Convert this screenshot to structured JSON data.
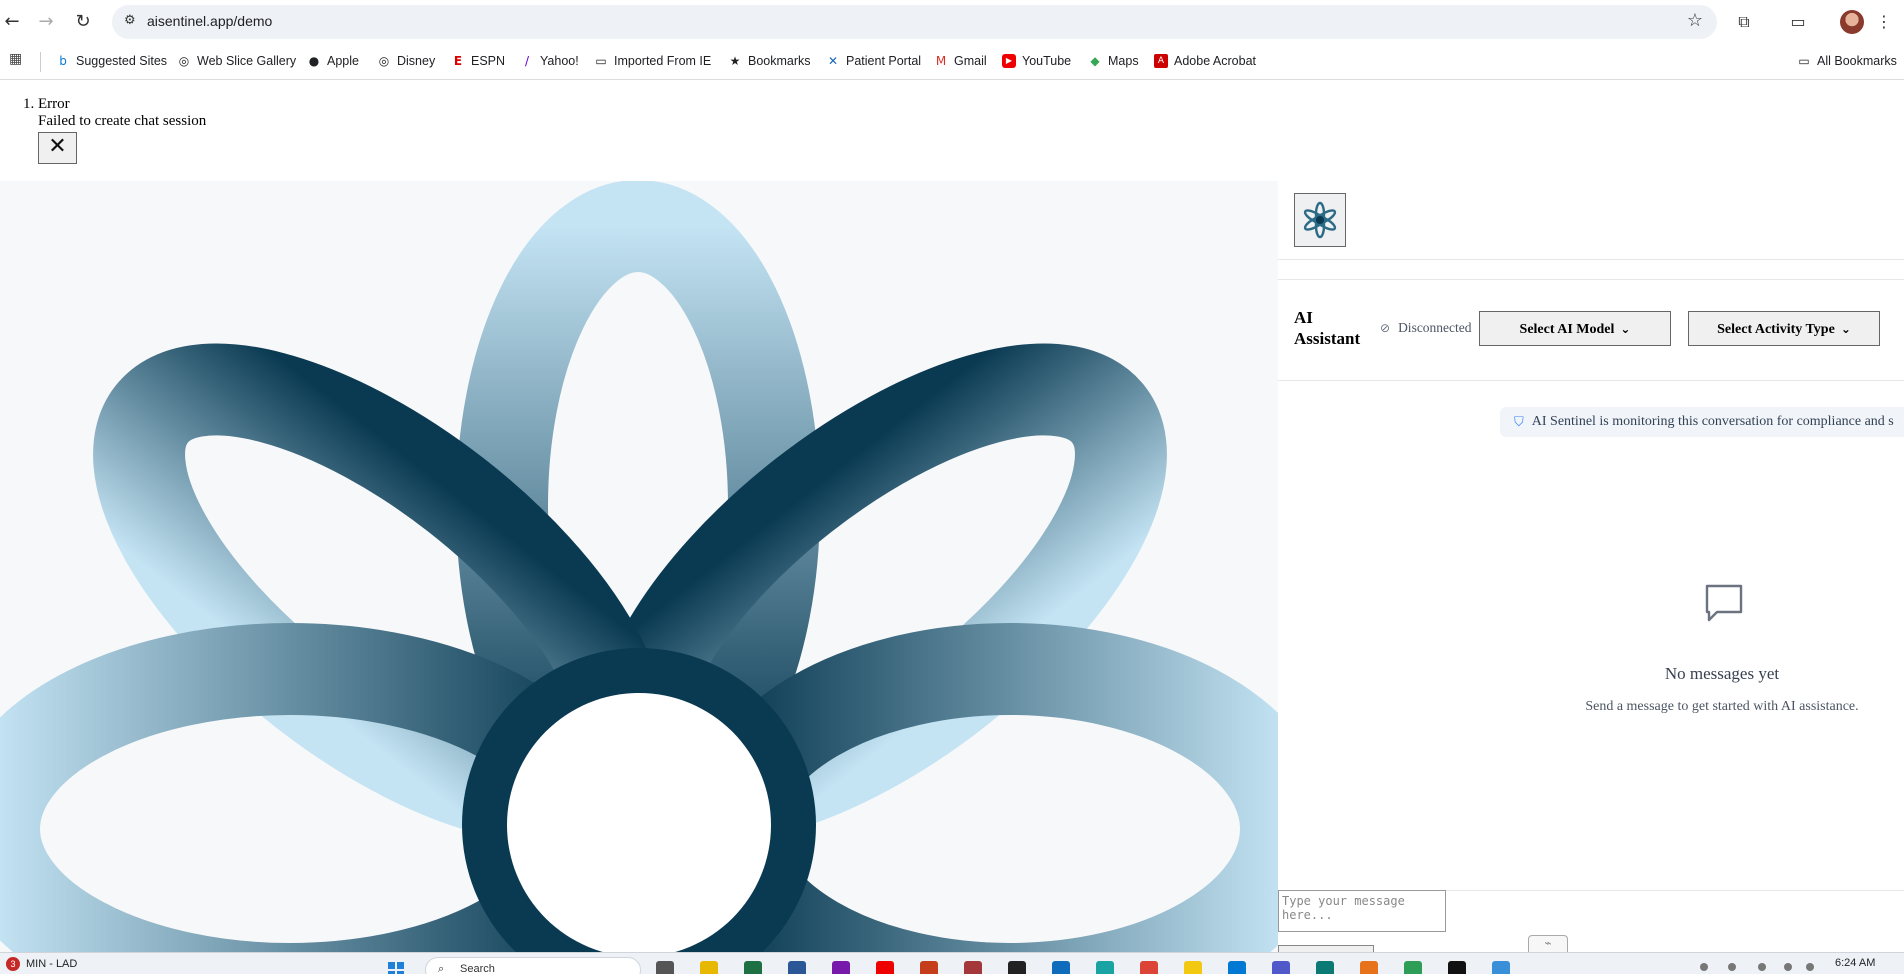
{
  "browser": {
    "url": "aisentinel.app/demo",
    "bookmarks": [
      {
        "label": "Suggested Sites",
        "icon": "bing-icon"
      },
      {
        "label": "Web Slice Gallery",
        "icon": "globe-icon"
      },
      {
        "label": "Apple",
        "icon": "apple-icon"
      },
      {
        "label": "Disney",
        "icon": "globe-icon"
      },
      {
        "label": "ESPN",
        "icon": "espn-icon"
      },
      {
        "label": "Yahoo!",
        "icon": "yahoo-icon"
      },
      {
        "label": "Imported From IE",
        "icon": "folder-icon"
      },
      {
        "label": "Bookmarks",
        "icon": "star-icon"
      },
      {
        "label": "Patient Portal",
        "icon": "x-icon"
      },
      {
        "label": "Gmail",
        "icon": "gmail-icon"
      },
      {
        "label": "YouTube",
        "icon": "youtube-icon"
      },
      {
        "label": "Maps",
        "icon": "maps-icon"
      },
      {
        "label": "Adobe Acrobat",
        "icon": "acrobat-icon"
      }
    ],
    "all_bookmarks": "All Bookmarks"
  },
  "error": {
    "title": "Error",
    "message": "Failed to create chat session",
    "close_glyph": "✕"
  },
  "chat": {
    "title": "AI Assistant",
    "status": "Disconnected",
    "model_select": "Select AI Model",
    "activity_select": "Select Activity Type",
    "monitor_notice": "AI Sentinel is monitoring this conversation for compliance and s",
    "empty_title": "No messages yet",
    "empty_subtitle": "Send a message to get started with AI assistance.",
    "input_placeholder": "Type your message here..."
  },
  "taskbar": {
    "notification_count": "3",
    "weather_text": "MIN - LAD",
    "search_placeholder": "Search",
    "time": "6:24 AM"
  },
  "colors": {
    "logo_dark": "#0a3a52",
    "logo_light": "#c4e4f4",
    "panel_bg": "#f7f8fa",
    "accent_blue": "#3b82f6"
  }
}
